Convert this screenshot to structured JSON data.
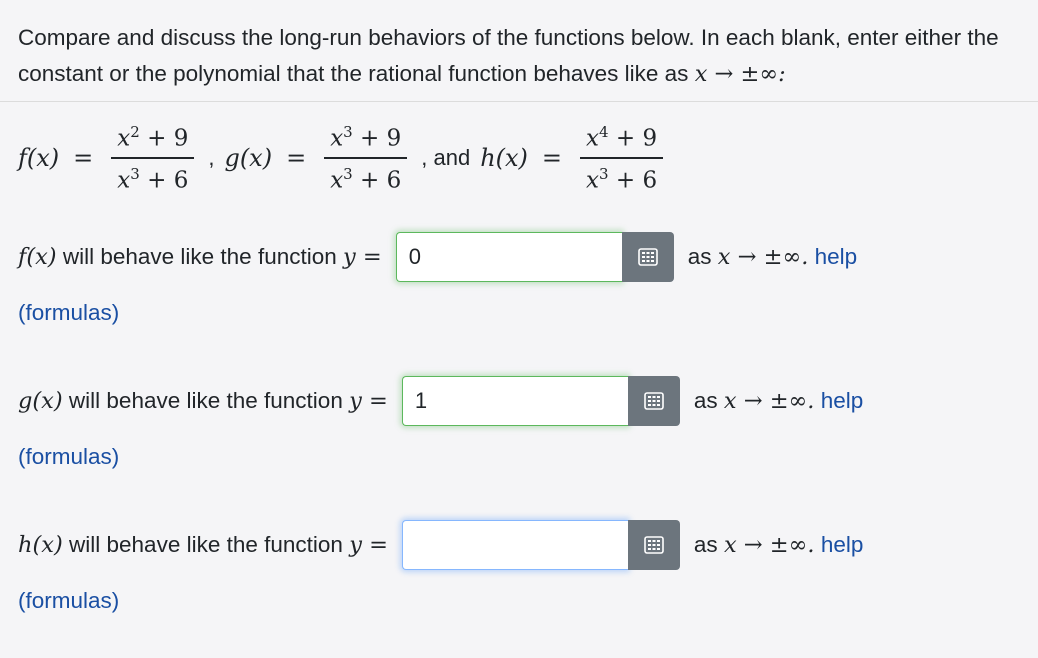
{
  "intro": {
    "text": "Compare and discuss the long-run behaviors of the functions below. In each blank, enter either the constant or the polynomial that the rational function behaves like as",
    "limit": "x → ±∞:"
  },
  "functions": {
    "f_lhs": "f(x)",
    "f_num": "x",
    "f_num_exp": "2",
    "f_num_tail": " + 9",
    "f_den": "x",
    "f_den_exp": "3",
    "f_den_tail": " + 6",
    "g_lhs": "g(x)",
    "g_num": "x",
    "g_num_exp": "3",
    "g_num_tail": " + 9",
    "g_den": "x",
    "g_den_exp": "3",
    "g_den_tail": " + 6",
    "h_lhs": "h(x)",
    "h_num": "x",
    "h_num_exp": "4",
    "h_num_tail": " + 9",
    "h_den": "x",
    "h_den_exp": "3",
    "h_den_tail": " + 6",
    "comma": ",",
    "and": ", and",
    "equals": "="
  },
  "questions": [
    {
      "fn": "f(x)",
      "text": "will behave like the function",
      "y": "y =",
      "value": "0",
      "as": "as",
      "limit": "x → ±∞.",
      "help": "help",
      "formulas": "(formulas)"
    },
    {
      "fn": "g(x)",
      "text": "will behave like the function",
      "y": "y =",
      "value": "1",
      "as": "as",
      "limit": "x → ±∞.",
      "help": "help",
      "formulas": "(formulas)"
    },
    {
      "fn": "h(x)",
      "text": "will behave like the function",
      "y": "y =",
      "value": "",
      "as": "as",
      "limit": "x → ±∞.",
      "help": "help",
      "formulas": "(formulas)"
    }
  ],
  "icons": {
    "keyboard": "keyboard-icon"
  },
  "colors": {
    "link": "#1a4fa3",
    "button": "#6c757d",
    "correct": "#5cb85c",
    "focus": "#86b7fe"
  }
}
